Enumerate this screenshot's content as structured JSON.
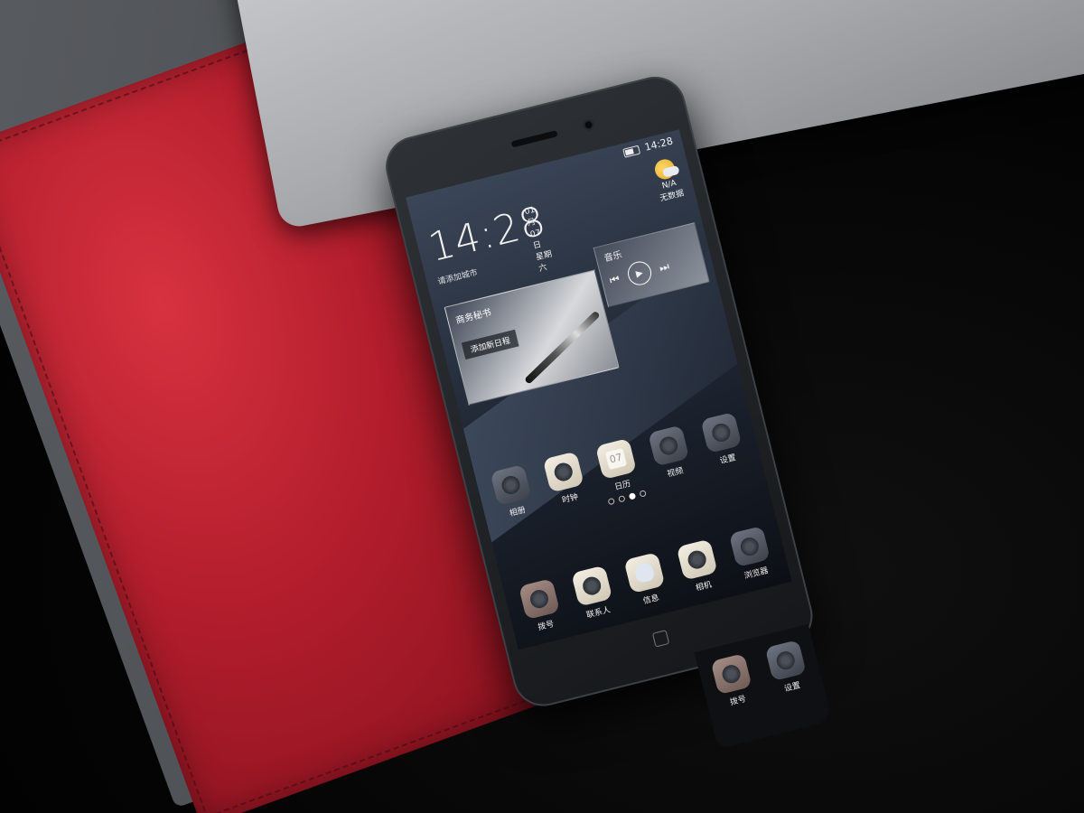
{
  "phone": {
    "status": {
      "time": "14:28"
    },
    "clock_widget": {
      "time": "14:28",
      "date": "01月07日",
      "weekday": "星期六",
      "city": "请添加城市"
    },
    "weather": {
      "temp": "N/A",
      "desc": "无数据"
    },
    "secretary_widget": {
      "title": "商务秘书",
      "action": "添加新日程"
    },
    "music_widget": {
      "title": "音乐",
      "prev": "⏮",
      "play": "▶",
      "next": "⏭"
    },
    "apps_row1": [
      {
        "label": "相册",
        "icon": "photo-icon"
      },
      {
        "label": "时钟",
        "icon": "clock-icon"
      },
      {
        "label": "日历",
        "icon": "calendar-icon",
        "glyph": "07"
      },
      {
        "label": "视频",
        "icon": "video-icon"
      },
      {
        "label": "设置",
        "icon": "settings-icon"
      }
    ],
    "apps_row2": [
      {
        "label": "拨号",
        "icon": "phone-icon"
      },
      {
        "label": "联系人",
        "icon": "contacts-icon"
      },
      {
        "label": "信息",
        "icon": "message-icon"
      },
      {
        "label": "相机",
        "icon": "camera-icon"
      },
      {
        "label": "浏览器",
        "icon": "browser-icon"
      }
    ],
    "shard_apps": [
      {
        "label": "拨号",
        "icon": "phone-icon"
      },
      {
        "label": "设置",
        "icon": "settings-icon"
      }
    ],
    "page_dots": 4,
    "active_dot": 2
  },
  "colors": {
    "background": "#050505",
    "folio_red": "#b21d2c",
    "laptop_silver": "#b4b6b9"
  }
}
